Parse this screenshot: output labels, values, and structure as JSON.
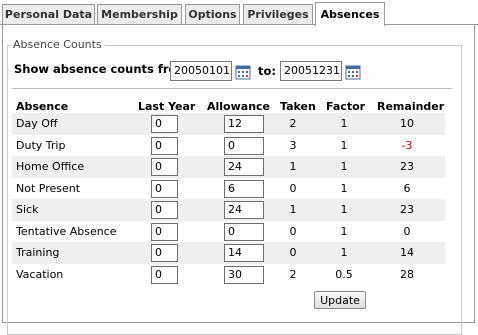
{
  "tabs": [
    {
      "label": "Personal Data"
    },
    {
      "label": "Membership"
    },
    {
      "label": "Options"
    },
    {
      "label": "Privileges"
    },
    {
      "label": "Absences",
      "active": true
    }
  ],
  "section": {
    "legend": "Absence Counts",
    "from_label": "Show absence counts from",
    "from_value": "20050101",
    "to_label": "to:",
    "to_value": "20051231"
  },
  "table": {
    "headers": [
      "Absence",
      "Last Year",
      "Allowance",
      "Taken",
      "Factor",
      "Remainder"
    ],
    "rows": [
      {
        "absence": "Day Off",
        "last_year": "0",
        "allowance": "12",
        "taken": "2",
        "factor": "1",
        "remainder": "10"
      },
      {
        "absence": "Duty Trip",
        "last_year": "0",
        "allowance": "0",
        "taken": "3",
        "factor": "1",
        "remainder": "-3"
      },
      {
        "absence": "Home Office",
        "last_year": "0",
        "allowance": "24",
        "taken": "1",
        "factor": "1",
        "remainder": "23"
      },
      {
        "absence": "Not Present",
        "last_year": "0",
        "allowance": "6",
        "taken": "0",
        "factor": "1",
        "remainder": "6"
      },
      {
        "absence": "Sick",
        "last_year": "0",
        "allowance": "24",
        "taken": "1",
        "factor": "1",
        "remainder": "23"
      },
      {
        "absence": "Tentative Absence",
        "last_year": "0",
        "allowance": "0",
        "taken": "0",
        "factor": "1",
        "remainder": "0"
      },
      {
        "absence": "Training",
        "last_year": "0",
        "allowance": "14",
        "taken": "0",
        "factor": "1",
        "remainder": "14"
      },
      {
        "absence": "Vacation",
        "last_year": "0",
        "allowance": "30",
        "taken": "2",
        "factor": "0.5",
        "remainder": "28"
      }
    ]
  },
  "update_label": "Update",
  "colors": {
    "negative": "#cc0000",
    "row_shade": "#efefef"
  },
  "icons": {
    "calendar": "calendar-icon"
  }
}
